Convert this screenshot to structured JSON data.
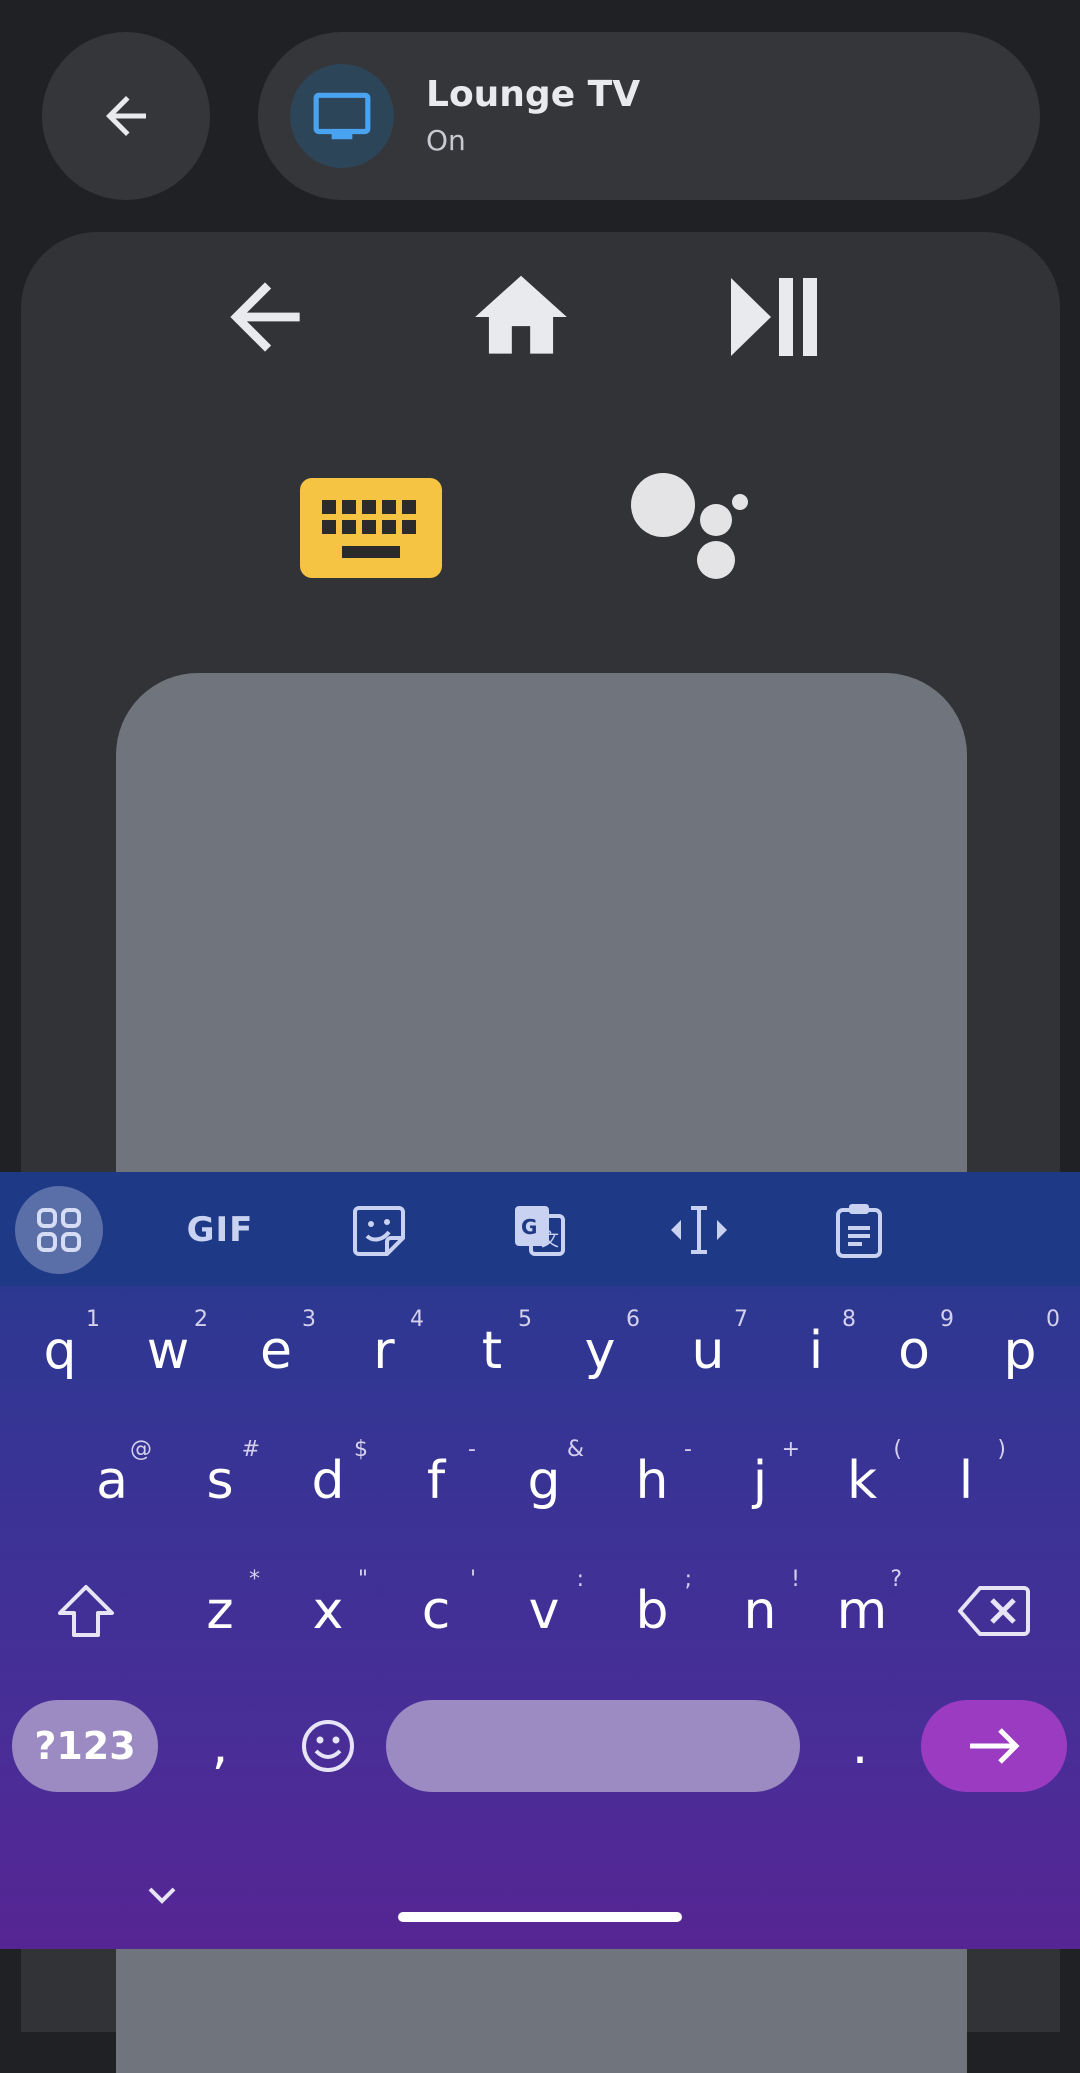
{
  "header": {
    "device_name": "Lounge TV",
    "device_status": "On"
  },
  "remote": {
    "buttons": [
      "back",
      "home",
      "play-pause",
      "keyboard",
      "assistant"
    ],
    "keyboard_accent": "#f6c443"
  },
  "keyboard": {
    "toolbar": {
      "gif_label": "GIF"
    },
    "rows": [
      [
        {
          "key": "q",
          "hint": "1"
        },
        {
          "key": "w",
          "hint": "2"
        },
        {
          "key": "e",
          "hint": "3"
        },
        {
          "key": "r",
          "hint": "4"
        },
        {
          "key": "t",
          "hint": "5"
        },
        {
          "key": "y",
          "hint": "6"
        },
        {
          "key": "u",
          "hint": "7"
        },
        {
          "key": "i",
          "hint": "8"
        },
        {
          "key": "o",
          "hint": "9"
        },
        {
          "key": "p",
          "hint": "0"
        }
      ],
      [
        {
          "key": "a",
          "hint": "@"
        },
        {
          "key": "s",
          "hint": "#"
        },
        {
          "key": "d",
          "hint": "$"
        },
        {
          "key": "f",
          "hint": "-"
        },
        {
          "key": "g",
          "hint": "&"
        },
        {
          "key": "h",
          "hint": "-"
        },
        {
          "key": "j",
          "hint": "+"
        },
        {
          "key": "k",
          "hint": "("
        },
        {
          "key": "l",
          "hint": ")"
        }
      ],
      [
        {
          "key": "z",
          "hint": "*"
        },
        {
          "key": "x",
          "hint": "\""
        },
        {
          "key": "c",
          "hint": "'"
        },
        {
          "key": "v",
          "hint": ":"
        },
        {
          "key": "b",
          "hint": ";"
        },
        {
          "key": "n",
          "hint": "!"
        },
        {
          "key": "m",
          "hint": "?"
        }
      ]
    ],
    "symbols_label": "?123",
    "comma_label": ",",
    "period_label": ".",
    "colors": {
      "enter": "#9a3bc2",
      "space": "#9b8bc2",
      "symbols": "#9b8bc2"
    }
  }
}
